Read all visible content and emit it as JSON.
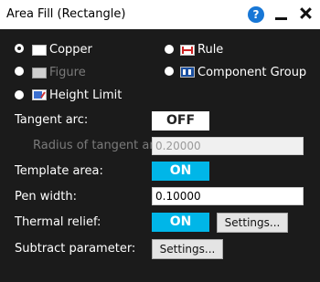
{
  "window": {
    "title": "Area Fill (Rectangle)",
    "help_glyph": "?"
  },
  "options": {
    "copper": "Copper",
    "rule": "Rule",
    "figure": "Figure",
    "component_group": "Component Group",
    "height_limit": "Height Limit"
  },
  "fields": {
    "tangent_arc_label": "Tangent arc:",
    "tangent_arc_value": "OFF",
    "radius_label": "Radius of tangent arc:",
    "radius_value": "0.20000",
    "template_area_label": "Template area:",
    "template_area_value": "ON",
    "pen_width_label": "Pen width:",
    "pen_width_value": "0.10000",
    "thermal_relief_label": "Thermal relief:",
    "thermal_relief_value": "ON",
    "thermal_settings_label": "Settings...",
    "subtract_label": "Subtract parameter:",
    "subtract_settings_label": "Settings..."
  },
  "colors": {
    "accent_on": "#00b6e8",
    "background": "#1b1b1b"
  }
}
